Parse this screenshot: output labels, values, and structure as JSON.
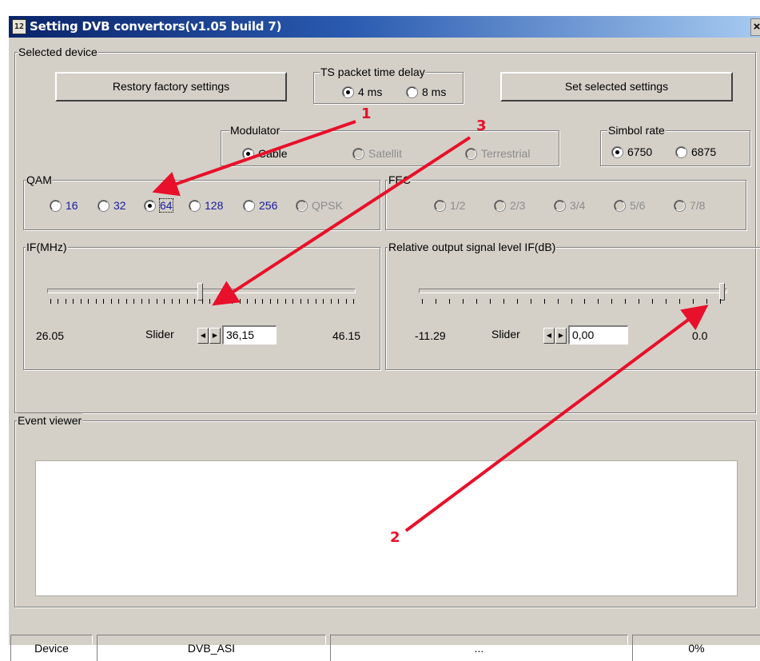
{
  "window": {
    "title": "Setting DVB convertors(v1.05 build 7)",
    "icon": "app-icon",
    "close_glyph": "×"
  },
  "selected_device": {
    "legend": "Selected device",
    "restore_button": "Restory factory settings",
    "set_button": "Set selected settings",
    "ts_delay": {
      "legend": "TS packet time delay",
      "options": [
        "4 ms",
        "8 ms"
      ],
      "selected": "4 ms"
    },
    "modulator": {
      "legend": "Modulator",
      "options": [
        "Cable",
        "Satellit",
        "Terrestrial"
      ],
      "selected": "Cable"
    },
    "symbol_rate": {
      "legend": "Simbol rate",
      "options": [
        "6750",
        "6875"
      ],
      "selected": "6750"
    },
    "qam": {
      "legend": "QAM",
      "options": [
        "16",
        "32",
        "64",
        "128",
        "256",
        "QPSK"
      ],
      "selected": "64"
    },
    "fec": {
      "legend": "FEC",
      "options": [
        "1/2",
        "2/3",
        "3/4",
        "5/6",
        "7/8"
      ]
    },
    "if": {
      "legend": "IF(MHz)",
      "min": "26.05",
      "max": "46.15",
      "slider_label": "Slider",
      "value": "36,15",
      "position": 0.5
    },
    "output_level": {
      "legend": "Relative output signal level IF(dB)",
      "min": "-11.29",
      "max": "0.0",
      "slider_label": "Slider",
      "value": "0,00",
      "position": 1.0
    }
  },
  "event_viewer": {
    "legend": "Event viewer"
  },
  "status_bar": {
    "device_label": "Device",
    "device_value": "DVB_ASI",
    "middle": "...",
    "progress": "0%"
  },
  "annotations": {
    "color": "#e8102a",
    "labels": [
      "1",
      "2",
      "3"
    ]
  }
}
